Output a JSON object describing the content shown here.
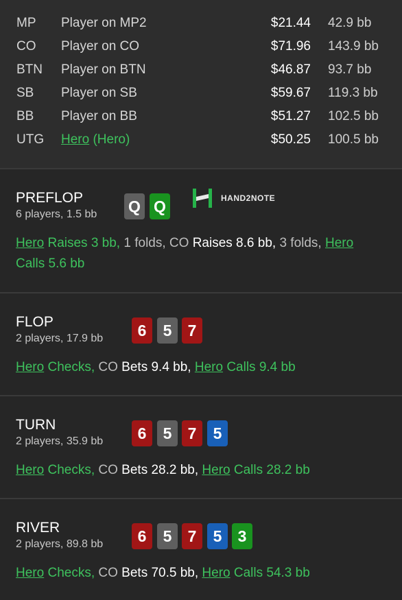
{
  "players": [
    {
      "pos": "MP",
      "name": "Player on MP2",
      "stack": "$21.44",
      "bb": "42.9 bb"
    },
    {
      "pos": "CO",
      "name": "Player on CO",
      "stack": "$71.96",
      "bb": "143.9 bb"
    },
    {
      "pos": "BTN",
      "name": "Player on BTN",
      "stack": "$46.87",
      "bb": "93.7 bb"
    },
    {
      "pos": "SB",
      "name": "Player on SB",
      "stack": "$59.67",
      "bb": "119.3 bb"
    },
    {
      "pos": "BB",
      "name": "Player on BB",
      "stack": "$51.27",
      "bb": "102.5 bb"
    },
    {
      "pos": "UTG",
      "hero_name": "Hero",
      "hero_suffix": " (Hero)",
      "stack": "$50.25",
      "bb": "100.5 bb"
    }
  ],
  "logo": {
    "text": "HAND2NOTE",
    "icon": "hand2note-logo-icon"
  },
  "preflop": {
    "title": "PREFLOP",
    "sub": "6 players, 1.5 bb",
    "cards": [
      {
        "rank": "Q",
        "color": "#5f5f5f"
      },
      {
        "rank": "Q",
        "color": "#19931f"
      }
    ],
    "action": {
      "hero1": "Hero",
      "a1": " Raises 3 bb,",
      "a2": " 1 folds,",
      "co": " CO",
      "a3": " Raises 8.6 bb,",
      "a4": " 3 folds,",
      "hero2": "Hero",
      "a5": "Calls 5.6 bb"
    }
  },
  "flop": {
    "title": "FLOP",
    "sub": "2 players, 17.9 bb",
    "cards": [
      {
        "rank": "6",
        "color": "#a11616"
      },
      {
        "rank": "5",
        "color": "#5f5f5f"
      },
      {
        "rank": "7",
        "color": "#a11616"
      }
    ],
    "action": {
      "hero1": "Hero",
      "a1": " Checks,",
      "co": " CO",
      "a2": " Bets 9.4 bb,",
      "hero2": "Hero",
      "a3": " Calls 9.4 bb"
    }
  },
  "turn": {
    "title": "TURN",
    "sub": "2 players, 35.9 bb",
    "cards": [
      {
        "rank": "6",
        "color": "#a11616"
      },
      {
        "rank": "5",
        "color": "#5f5f5f"
      },
      {
        "rank": "7",
        "color": "#a11616"
      },
      {
        "rank": "5",
        "color": "#1960b8"
      }
    ],
    "action": {
      "hero1": "Hero",
      "a1": " Checks,",
      "co": " CO",
      "a2": " Bets 28.2 bb,",
      "hero2": "Hero",
      "a3": " Calls 28.2 bb"
    }
  },
  "river": {
    "title": "RIVER",
    "sub": "2 players, 89.8 bb",
    "cards": [
      {
        "rank": "6",
        "color": "#a11616"
      },
      {
        "rank": "5",
        "color": "#5f5f5f"
      },
      {
        "rank": "7",
        "color": "#a11616"
      },
      {
        "rank": "5",
        "color": "#1960b8"
      },
      {
        "rank": "3",
        "color": "#19931f"
      }
    ],
    "action": {
      "hero1": "Hero",
      "a1": " Checks,",
      "co": " CO",
      "a2": " Bets 70.5 bb,",
      "hero2": "Hero",
      "a3": " Calls 54.3 bb"
    }
  }
}
